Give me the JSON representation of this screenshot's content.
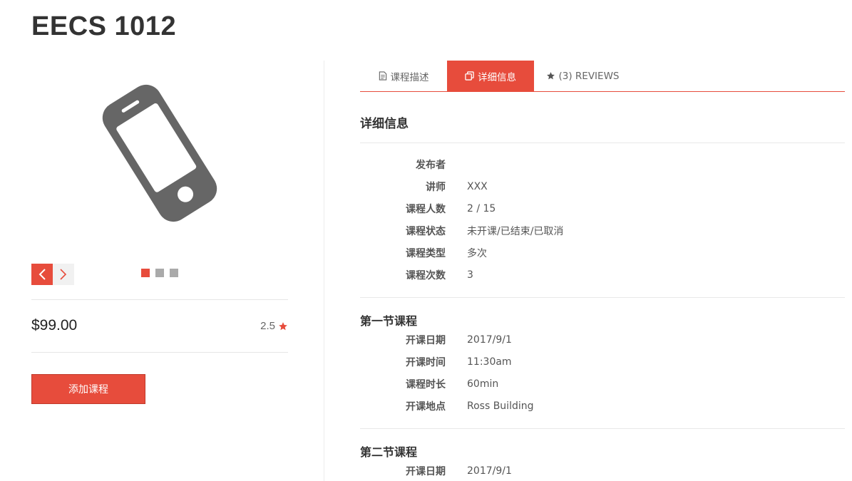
{
  "course": {
    "title": "EECS 1012",
    "price": "$99.00",
    "rating": "2.5",
    "add_button_label": "添加课程"
  },
  "slider": {
    "icon": "phone-icon",
    "dots": 3,
    "active_dot": 1
  },
  "tabs": [
    {
      "label": "课程描述",
      "icon": "document-icon",
      "active": false
    },
    {
      "label": "详细信息",
      "icon": "copy-icon",
      "active": true
    },
    {
      "label": "(3) REVIEWS",
      "icon": "star-icon",
      "active": false
    }
  ],
  "details": {
    "title": "详细信息",
    "rows": [
      {
        "label": "发布者",
        "value": ""
      },
      {
        "label": "讲师",
        "value": "XXX"
      },
      {
        "label": "课程人数",
        "value": "2 / 15"
      },
      {
        "label": "课程状态",
        "value": "未开课/已结束/已取消"
      },
      {
        "label": "课程类型",
        "value": "多次"
      },
      {
        "label": "课程次数",
        "value": "3"
      }
    ]
  },
  "sessions": [
    {
      "title": "第一节课程",
      "rows": [
        {
          "label": "开课日期",
          "value": "2017/9/1"
        },
        {
          "label": "开课时间",
          "value": "11:30am"
        },
        {
          "label": "课程时长",
          "value": "60min"
        },
        {
          "label": "开课地点",
          "value": "Ross Building"
        }
      ]
    },
    {
      "title": "第二节课程",
      "rows": [
        {
          "label": "开课日期",
          "value": "2017/9/1"
        }
      ]
    }
  ],
  "colors": {
    "accent": "#e74c3c",
    "icon_gray": "#666666",
    "dot_gray": "#aaaaaa"
  }
}
